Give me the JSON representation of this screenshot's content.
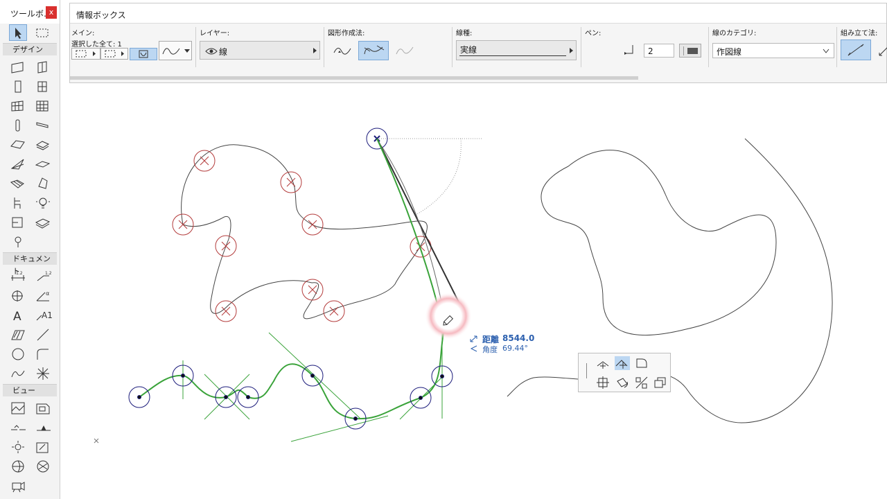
{
  "toolbox": {
    "title": "ツールボ…",
    "close_label": "x",
    "sections": {
      "design": "デザイン",
      "document": "ドキュメント",
      "view": "ビュー"
    }
  },
  "infobox": {
    "title": "情報ボックス",
    "main_label": "メイン:",
    "selected_label": "選択した全て: 1",
    "layer_label": "レイヤー:",
    "layer_value": "線",
    "geometry_label": "図形作成法:",
    "linetype_label": "線種:",
    "linetype_value": "実線",
    "pen_label": "ペン:",
    "pen_value": "2",
    "category_label": "線のカテゴリ:",
    "category_value": "作図線",
    "assembly_label": "組み立て法:"
  },
  "tracker": {
    "distance_label": "距離",
    "distance_value": "8544.0",
    "angle_label": "角度",
    "angle_value": "69.44°"
  },
  "colors": {
    "accent_blue": "#bcd7f2",
    "close_red": "#d9302e",
    "spline_green": "#3aa33a",
    "node_red": "#b33a3a",
    "node_blue": "#1a1a7a",
    "tracker_blue": "#2b5fae"
  },
  "icons": [
    "arrow-select-icon",
    "marquee-icon",
    "wall-icon",
    "door-icon",
    "window-icon",
    "pencil-icon",
    "close-icon"
  ]
}
